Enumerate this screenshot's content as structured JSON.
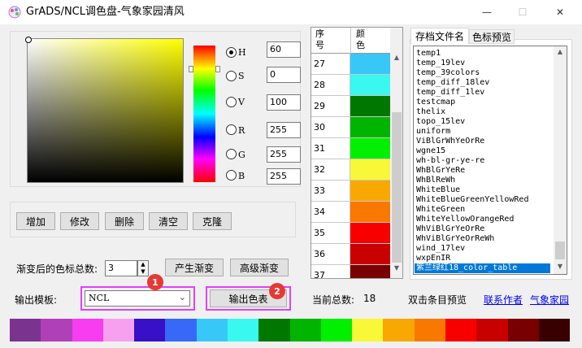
{
  "window": {
    "title": "GrADS/NCL调色盘-气象家园清风",
    "min_glyph": "—",
    "max_glyph": "☐",
    "close_glyph": "✕"
  },
  "picker": {
    "radios": [
      {
        "key": "H",
        "value": "60",
        "checked": true
      },
      {
        "key": "S",
        "value": "0",
        "checked": false
      },
      {
        "key": "V",
        "value": "100",
        "checked": false
      },
      {
        "key": "R",
        "value": "255",
        "checked": false
      },
      {
        "key": "G",
        "value": "255",
        "checked": false
      },
      {
        "key": "B",
        "value": "255",
        "checked": false
      }
    ]
  },
  "actions": {
    "add": "增加",
    "modify": "修改",
    "delete": "删除",
    "clear": "清空",
    "clone": "克隆"
  },
  "gradient": {
    "count_label": "渐变后的色标总数:",
    "count_value": "3",
    "generate": "产生渐变",
    "advanced": "高级渐变"
  },
  "output": {
    "template_label": "输出模板:",
    "template_value": "NCL",
    "export": "输出色表"
  },
  "badges": {
    "one": "1",
    "two": "2"
  },
  "table": {
    "header_num": "序\n号",
    "header_color": "颜\n色",
    "rows": [
      {
        "num": "27",
        "color": "#38c8f8"
      },
      {
        "num": "28",
        "color": "#38f8f0"
      },
      {
        "num": "29",
        "color": "#007800"
      },
      {
        "num": "30",
        "color": "#00b400"
      },
      {
        "num": "31",
        "color": "#00f000"
      },
      {
        "num": "32",
        "color": "#f8f838"
      },
      {
        "num": "33",
        "color": "#f8a800"
      },
      {
        "num": "34",
        "color": "#f87800"
      },
      {
        "num": "35",
        "color": "#f80000"
      },
      {
        "num": "36",
        "color": "#c80000"
      },
      {
        "num": "37",
        "color": "#780000"
      },
      {
        "num": "38",
        "color": "#380000"
      }
    ]
  },
  "tabs": {
    "files": "存档文件名",
    "preview": "色标预览"
  },
  "files": [
    "temp1",
    "temp_19lev",
    "temp_39colors",
    "temp_diff_18lev",
    "temp_diff_1lev",
    "testcmap",
    "thelix",
    "topo_15lev",
    "uniform",
    "ViBlGrWhYeOrRe",
    "wgne15",
    "wh-bl-gr-ye-re",
    "WhBlGrYeRe",
    "WhBlReWh",
    "WhiteBlue",
    "WhiteBlueGreenYellowRed",
    "WhiteGreen",
    "WhiteYellowOrangeRed",
    "WhViBlGrYeOrRe",
    "WhViBlGrYeOrReWh",
    "wind_17lev",
    "wxpEnIR",
    "紫兰绿红18_color_table"
  ],
  "status": {
    "total_label": "当前总数:",
    "total_value": "18",
    "dblclick_hint": "双击条目预览",
    "contact": "联系作者",
    "home": "气象家园"
  },
  "palette": [
    "#7b3390",
    "#b040b8",
    "#f83cf0",
    "#f8a0f0",
    "#3810c8",
    "#3868f8",
    "#38c8f8",
    "#38f8f0",
    "#007800",
    "#00b400",
    "#00f000",
    "#f8f838",
    "#f8a800",
    "#f87800",
    "#f80000",
    "#c80000",
    "#780000",
    "#380000"
  ],
  "hue_slider_value": 60
}
